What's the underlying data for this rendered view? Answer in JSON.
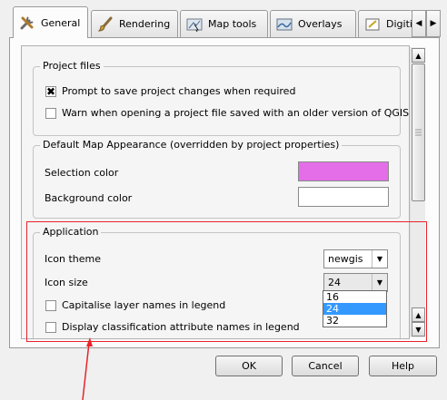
{
  "tabs": [
    {
      "label": "General",
      "icon": "tools-icon",
      "active": true
    },
    {
      "label": "Rendering",
      "icon": "brush-icon",
      "active": false
    },
    {
      "label": "Map tools",
      "icon": "map-tools-icon",
      "active": false
    },
    {
      "label": "Overlays",
      "icon": "overlays-icon",
      "active": false
    },
    {
      "label": "Digitiz",
      "icon": "digitizing-icon",
      "active": false
    }
  ],
  "tab_nav": {
    "prev": "◀",
    "next": "▶"
  },
  "project_files": {
    "title": "Project files",
    "prompt_save": {
      "label": "Prompt to save project changes when required",
      "checked": true
    },
    "warn_older": {
      "label": "Warn when opening a project file saved with an older version of QGIS",
      "checked": false
    }
  },
  "map_appearance": {
    "title": "Default Map Appearance (overridden by project properties)",
    "selection_color_label": "Selection color",
    "selection_color": "#e36ee8",
    "background_color_label": "Background color",
    "background_color": "#ffffff"
  },
  "application": {
    "title": "Application",
    "icon_theme_label": "Icon theme",
    "icon_theme_value": "newgis",
    "icon_size_label": "Icon size",
    "icon_size_value": "24",
    "icon_size_options": [
      "16",
      "24",
      "32"
    ],
    "icon_size_selected": "24",
    "capitalise": {
      "label": "Capitalise layer names in legend",
      "checked": false
    },
    "display_class": {
      "label": "Display classification attribute names in legend",
      "checked": false
    }
  },
  "buttons": {
    "ok": "OK",
    "cancel": "Cancel",
    "help": "Help"
  },
  "annotation_color": "#e8232a"
}
